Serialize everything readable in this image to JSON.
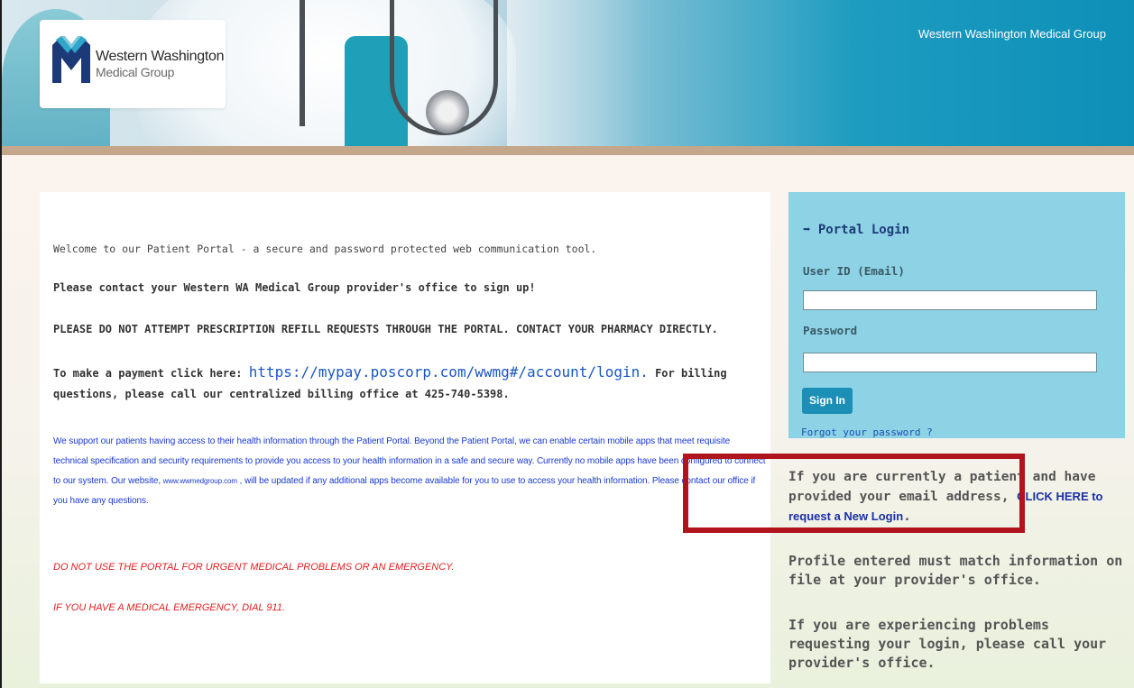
{
  "header": {
    "logo_name": "Western Washington",
    "logo_sub": "Medical Group",
    "org_title": "Western Washington Medical Group",
    "brand_navy": "#1d3a78",
    "brand_teal": "#1b8fb5"
  },
  "main": {
    "welcome": "Welcome to our Patient Portal - a secure and password protected web communication tool.",
    "contact": "Please contact your Western WA Medical Group provider's office to sign up!",
    "no_refill": "PLEASE DO NOT ATTEMPT PRESCRIPTION REFILL REQUESTS THROUGH THE PORTAL. CONTACT YOUR PHARMACY DIRECTLY.",
    "payment_prefix": "To make a payment click here: ",
    "payment_link": "https://mypay.poscorp.com/wwmg#/account/login.",
    "payment_suffix": " For billing questions, please call our centralized billing office at 425-740-5398.",
    "support_part1": "We support our patients having access to their health information through the Patient Portal. Beyond the Patient Portal, we can enable certain mobile apps that meet requisite technical specification and security requirements to provide you access to your health information in a safe and secure way. Currently no mobile apps have been configured to connect to our system. Our website, ",
    "support_site": "www.wwmedgroup.com",
    "support_part2": " , will be updated if any additional apps become available for you to use to access your health information. Please contact our office if you have any questions.",
    "urgent": "DO NOT USE THE PORTAL FOR URGENT MEDICAL PROBLEMS OR AN EMERGENCY.",
    "emergency": "IF YOU HAVE A MEDICAL EMERGENCY, DIAL 911."
  },
  "login": {
    "icon": "sign-in-icon",
    "icon_glyph": "➡",
    "title": "Portal Login",
    "user_label": "User ID (Email)",
    "user_value": "",
    "password_label": "Password",
    "password_value": "",
    "signin_label": "Sign In",
    "forgot": "Forgot your password ?"
  },
  "side": {
    "request_prefix": "If you are currently a patient and have provided your email address, ",
    "request_link": "CLICK HERE to request a New Login",
    "request_suffix": ".",
    "match": "Profile entered must match information on file at your provider's office.",
    "problems": "If you are experiencing problems requesting your login, please call your provider's office."
  },
  "annotation": {
    "highlight_color": "#b0141c"
  }
}
